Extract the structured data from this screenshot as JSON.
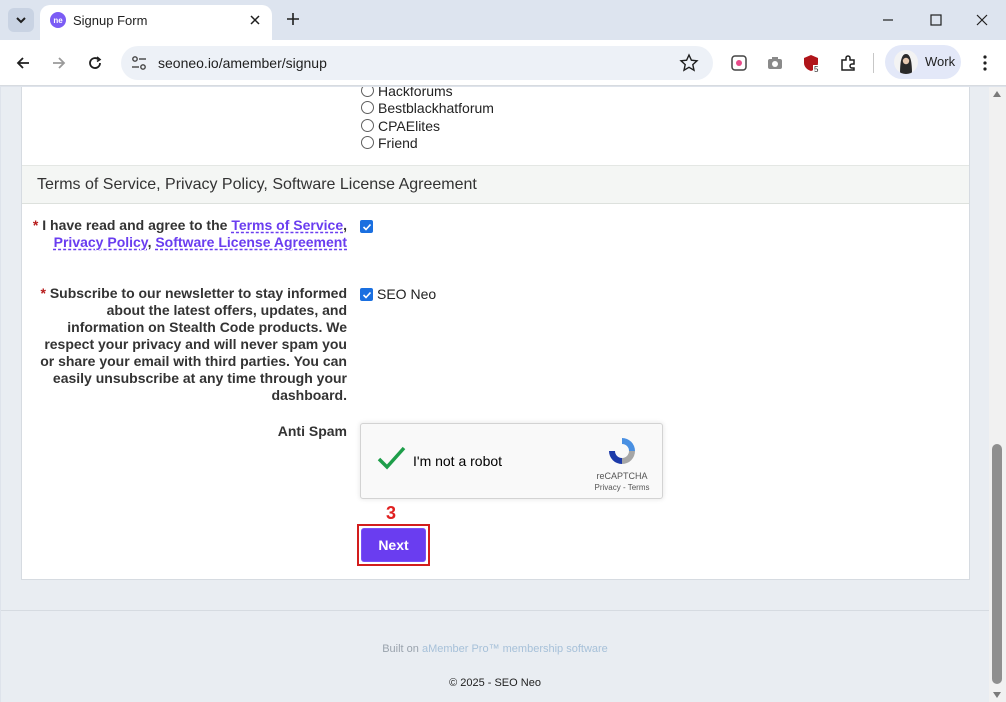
{
  "browser": {
    "tab_title": "Signup Form",
    "favicon_text": "ne",
    "url": "seoneo.io/amember/signup",
    "profile_label": "Work",
    "extension_badge": "5"
  },
  "form": {
    "radio_options": [
      "Hackforums",
      "Bestblackhatforum",
      "CPAElites",
      "Friend"
    ],
    "section_title": "Terms of Service, Privacy Policy, Software License Agreement",
    "agree": {
      "required_mark": "*",
      "text_before": " I have read and agree to the ",
      "terms_link": "Terms of Service",
      "comma1": ",",
      "privacy_link": "Privacy Policy",
      "comma2": ", ",
      "license_link": "Software License Agreement",
      "checked": true
    },
    "newsletter": {
      "required_mark": "*",
      "text": " Subscribe to our newsletter to stay informed about the latest offers, updates, and information on Stealth Code products. We respect your privacy and will never spam you or share your email with third parties. You can easily unsubscribe at any time through your dashboard.",
      "option_label": "SEO Neo",
      "checked": true
    },
    "antispam_label": "Anti Spam",
    "recaptcha": {
      "label": "I'm not a robot",
      "brand": "reCAPTCHA",
      "links": "Privacy - Terms"
    },
    "step_annotation": "3",
    "next_label": "Next"
  },
  "footer": {
    "built_prefix": "Built on ",
    "built_link": "aMember Pro™ membership software",
    "copyright": "© 2025 - SEO Neo"
  },
  "colors": {
    "accent": "#6a3df0",
    "annotation": "#e02020",
    "checkbox": "#1a6fe0"
  }
}
